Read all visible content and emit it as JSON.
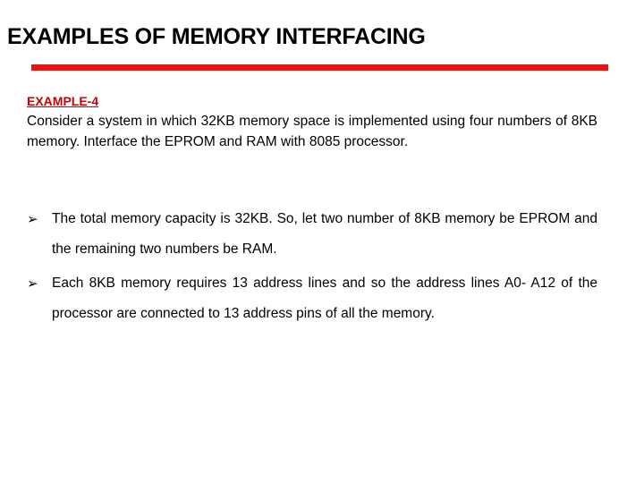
{
  "slide": {
    "title": "EXAMPLES OF MEMORY INTERFACING",
    "accent_color": "#ee1111",
    "label_color": "#cc0000",
    "background_color": "#ffffff",
    "text_color": "#000000"
  },
  "content": {
    "example_label": "EXAMPLE-4",
    "intro_paragraph": "Consider a system in which 32KB memory space is implemented using four numbers of 8KB memory. Interface the EPROM and RAM with 8085 processor.",
    "bullets": [
      {
        "marker": "➢",
        "text": "The total memory capacity is 32KB. So, let two number of 8KB memory be EPROM and the remaining two numbers be RAM."
      },
      {
        "marker": "➢",
        "text": "Each 8KB memory requires 13 address lines and so the address lines A0- A12 of the processor are connected to 13 address pins of all the memory."
      }
    ]
  }
}
